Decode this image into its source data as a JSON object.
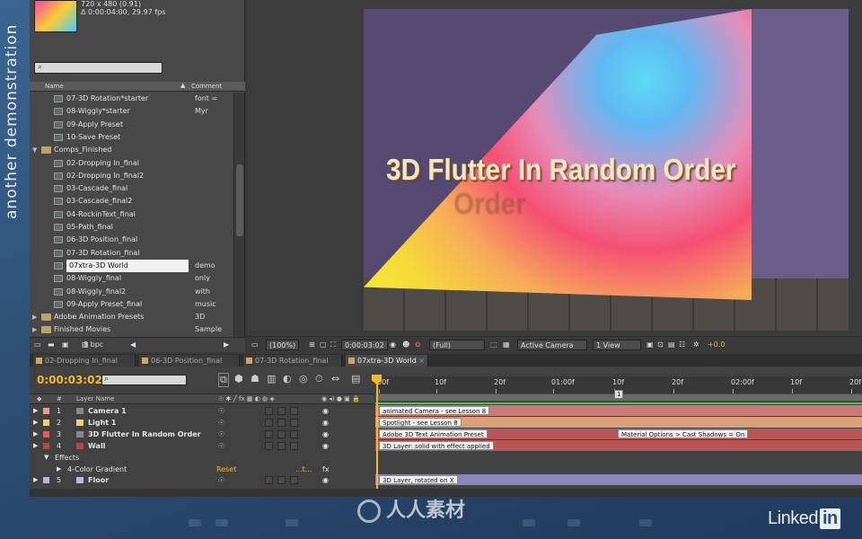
{
  "side_text": "another demonstration",
  "project": {
    "thumb_info_line1": "720 x 480 (0.91)",
    "thumb_info_line2": "Δ 0:00:04:00, 29.97 fps",
    "search_icon": "search-icon",
    "col_name": "Name",
    "col_comment": "Comment",
    "items": [
      {
        "name": "07-3D Rotation*starter",
        "comment": "font = Myr",
        "type": "comp"
      },
      {
        "name": "08-Wiggly*starter",
        "comment": "",
        "type": "comp"
      },
      {
        "name": "09-Apply Preset",
        "comment": "",
        "type": "comp"
      },
      {
        "name": "10-Save Preset",
        "comment": "",
        "type": "comp"
      },
      {
        "name": "Comps_Finished",
        "comment": "",
        "type": "folder"
      },
      {
        "name": "02-Dropping In_final",
        "comment": "",
        "type": "comp"
      },
      {
        "name": "02-Dropping In_final2",
        "comment": "",
        "type": "comp"
      },
      {
        "name": "03-Cascade_final",
        "comment": "",
        "type": "comp"
      },
      {
        "name": "03-Cascade_final2",
        "comment": "",
        "type": "comp"
      },
      {
        "name": "04-RockinText_final",
        "comment": "",
        "type": "comp"
      },
      {
        "name": "05-Path_final",
        "comment": "",
        "type": "comp"
      },
      {
        "name": "06-3D Position_final",
        "comment": "",
        "type": "comp"
      },
      {
        "name": "07-3D Rotation_final",
        "comment": "",
        "type": "comp"
      },
      {
        "name": "07xtra-3D World",
        "comment": "demo only",
        "type": "comp",
        "selected": true
      },
      {
        "name": "08-Wiggly_final",
        "comment": "",
        "type": "comp"
      },
      {
        "name": "08-Wiggly_final2",
        "comment": "with music",
        "type": "comp"
      },
      {
        "name": "09-Apply Preset_final",
        "comment": "",
        "type": "comp"
      },
      {
        "name": "Adobe Animation Presets",
        "comment": "3D Sample",
        "type": "folder"
      },
      {
        "name": "Finished Movies",
        "comment": "",
        "type": "folder"
      }
    ],
    "bpc": "8 bpc"
  },
  "viewer": {
    "title_text": "3D Flutter In Random Order",
    "zoom": "(100%)",
    "timecode": "0:00:03:02",
    "resolution": "(Full)",
    "camera": "Active Camera",
    "views": "1 View",
    "exposure": "+0.0"
  },
  "tabs": [
    {
      "label": "02-Dropping In_final",
      "color": "#c9a66b"
    },
    {
      "label": "06-3D Position_final",
      "color": "#c9a66b"
    },
    {
      "label": "07-3D Rotation_final",
      "color": "#c9a66b"
    },
    {
      "label": "07xtra-3D World",
      "color": "#c9a66b",
      "active": true
    }
  ],
  "timeline": {
    "timecode": "0:00:03:02",
    "header_num": "#",
    "header_layer": "Layer Name",
    "ruler_labels": [
      "00f",
      "10f",
      "20f",
      "01:00f",
      "10f",
      "20f",
      "02:00f",
      "10f",
      "20f"
    ],
    "marker": "1",
    "layers": [
      {
        "num": "1",
        "name": "Camera 1",
        "label_color": "#e0a0a0",
        "icon": "camera-icon",
        "track_label": "animated Camera - see Lesson 8",
        "track_color": "#c97a78"
      },
      {
        "num": "2",
        "name": "Light 1",
        "label_color": "#f2d36b",
        "icon": "light-icon",
        "track_label": "Spotlight - see Lesson 8",
        "track_color": "#d9a07a"
      },
      {
        "num": "3",
        "name": "3D Flutter In Random Order",
        "label_color": "#d86060",
        "icon": "text-icon",
        "track_label": "Adobe 3D Text Animation Preset",
        "track_label2": "Material Options > Cast Shadows = On",
        "track_color": "#b85656"
      },
      {
        "num": "4",
        "name": "Wall",
        "label_color": "#c24545",
        "icon": "solid-icon",
        "track_label": "3D Layer: solid with effect applied",
        "track_color": "#b85656"
      }
    ],
    "effects_label": "Effects",
    "effect_name": "4-Color Gradient",
    "effect_reset": "Reset",
    "effect_dots": "...t...",
    "effect_fx": "fx",
    "floor": {
      "num": "5",
      "name": "Floor",
      "label_color": "#c0b3e0",
      "track_label": "3D Layer, rotated on X",
      "track_color": "#8a84b8"
    }
  },
  "watermarks": {
    "lynda": "Linked",
    "lynda_in": "in",
    "rr": "人人素材"
  }
}
